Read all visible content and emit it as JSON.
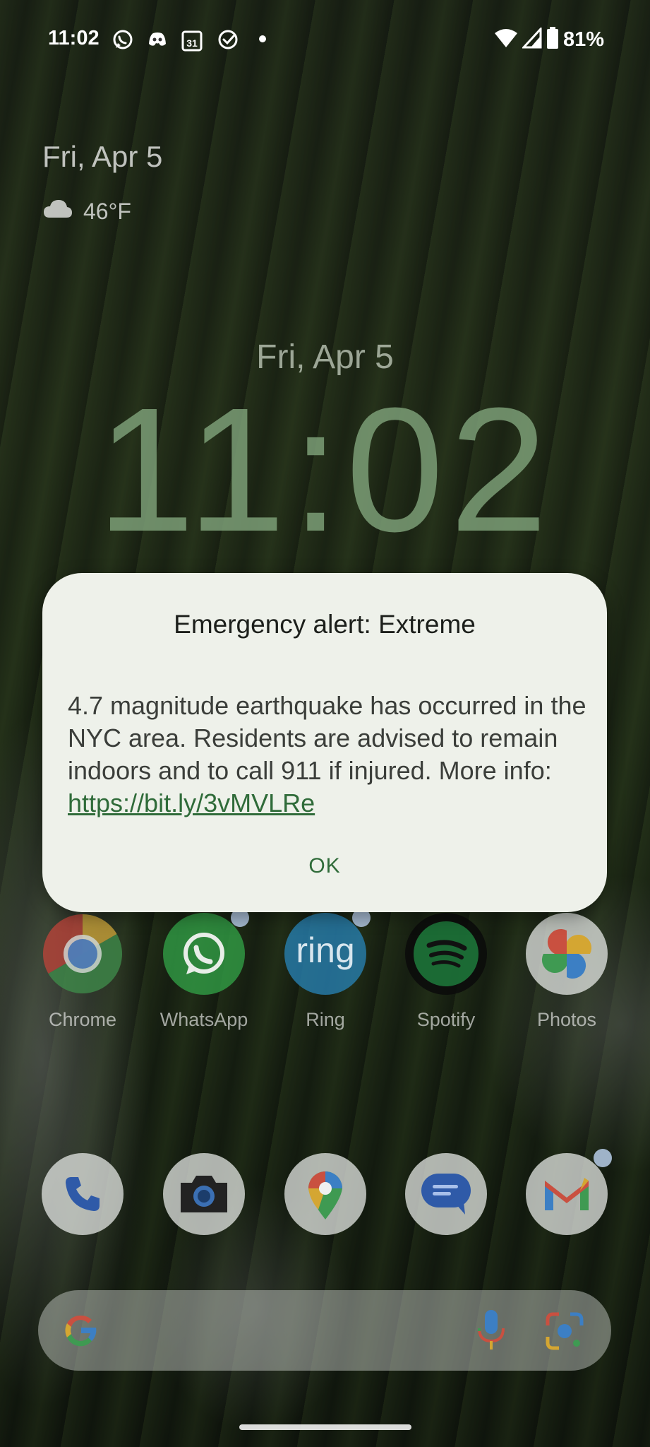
{
  "status_bar": {
    "time": "11:02",
    "calendar_day": "31",
    "battery_percent": "81%",
    "notification_icons": [
      "whatsapp-icon",
      "discord-icon",
      "calendar-icon",
      "tasks-check-icon",
      "more-dot-icon"
    ]
  },
  "lockscreen": {
    "small_date": "Fri, Apr 5",
    "temperature": "46°F",
    "date": "Fri, Apr 5",
    "clock": "11:02"
  },
  "apps_row": [
    {
      "label": "Chrome",
      "badge": false
    },
    {
      "label": "WhatsApp",
      "badge": true
    },
    {
      "label": "Ring",
      "icon_text": "ring",
      "badge": true
    },
    {
      "label": "Spotify",
      "badge": false
    },
    {
      "label": "Photos",
      "badge": false
    }
  ],
  "dock": [
    {
      "name": "phone-icon"
    },
    {
      "name": "camera-icon"
    },
    {
      "name": "maps-icon"
    },
    {
      "name": "messages-icon"
    },
    {
      "name": "gmail-icon",
      "badge": true
    }
  ],
  "search_bar": {
    "icons": [
      "google-g-icon",
      "mic-icon",
      "lens-icon"
    ]
  },
  "alert_dialog": {
    "title": "Emergency alert: Extreme",
    "body_text": "4.7 magnitude earthquake has occurred in the NYC area. Residents are advised to remain indoors and to call 911 if injured. More info: ",
    "link_text": "https://bit.ly/3vMVLRe",
    "ok_label": "OK"
  },
  "colors": {
    "dialog_bg": "#eef1ea",
    "accent_green": "#2f6b39",
    "clock_green": "#7fa27a"
  }
}
